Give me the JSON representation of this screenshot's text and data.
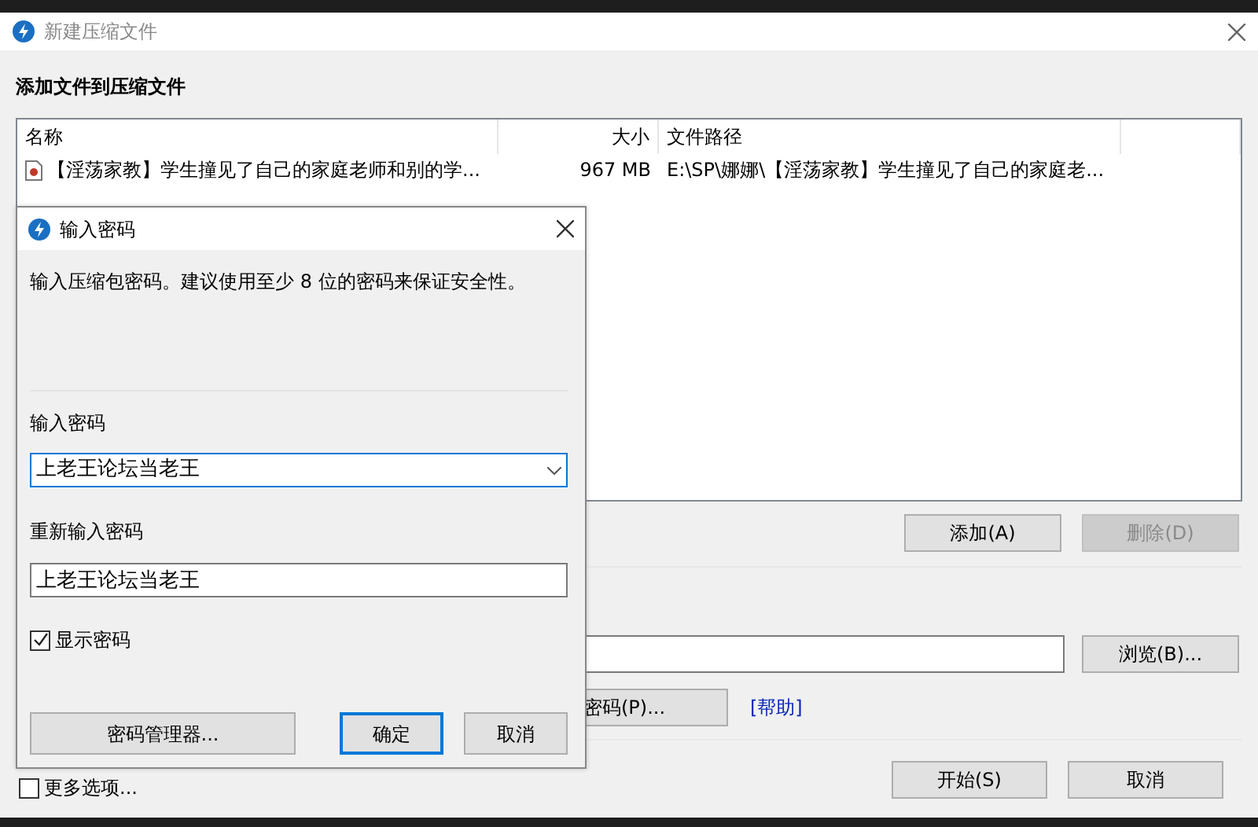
{
  "window": {
    "title": "新建压缩文件",
    "heading": "添加文件到压缩文件"
  },
  "file_list": {
    "columns": [
      "名称",
      "大小",
      "文件路径"
    ],
    "rows": [
      {
        "name": "【淫荡家教】学生撞见了自己的家庭老师和别的学...",
        "size": "967 MB",
        "path": "E:\\SP\\娜娜\\【淫荡家教】学生撞见了自己的家庭老..."
      }
    ]
  },
  "list_buttons": [
    {
      "label": "添加(A)",
      "disabled": false
    },
    {
      "label": "删除(D)",
      "disabled": true
    }
  ],
  "browse_button": "浏览(B)...",
  "password_button": "密码(P)...",
  "help_link": "[帮助]",
  "more_options": {
    "label": "更多选项...",
    "checked": false
  },
  "footer_buttons": [
    "开始(S)",
    "取消"
  ],
  "dialog": {
    "title": "输入密码",
    "message": "输入压缩包密码。建议使用至少 8 位的密码来保证安全性。",
    "password_label": "输入密码",
    "password_value": "上老王论坛当老王",
    "confirm_label": "重新输入密码",
    "confirm_value": "上老王论坛当老王",
    "show_password": {
      "label": "显示密码",
      "checked": true
    },
    "buttons": [
      {
        "label": "密码管理器...",
        "focused": false
      },
      {
        "label": "确定",
        "focused": true
      },
      {
        "label": "取消",
        "focused": false
      }
    ]
  }
}
